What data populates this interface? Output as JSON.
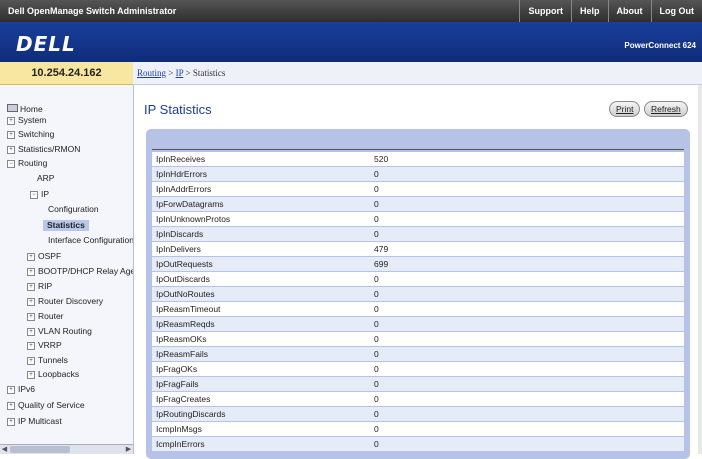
{
  "app_title": "Dell OpenManage Switch Administrator",
  "top_nav": [
    "Support",
    "Help",
    "About",
    "Log Out"
  ],
  "logo_text": "DELL",
  "product_name": "PowerConnect 624",
  "ip_address": "10.254.24.162",
  "breadcrumb": {
    "routing": "Routing",
    "sep1": " > ",
    "ip": "IP",
    "sep2": " > ",
    "current": "Statistics"
  },
  "sidebar": {
    "items": [
      {
        "label": "Home",
        "pm": "",
        "icon": "home-icon"
      },
      {
        "label": "System",
        "pm": "+"
      },
      {
        "label": "Switching",
        "pm": "+"
      },
      {
        "label": "Statistics/RMON",
        "pm": "+"
      },
      {
        "label": "Routing",
        "pm": "−"
      },
      {
        "label": "ARP",
        "pm": ""
      },
      {
        "label": "IP",
        "pm": "−"
      },
      {
        "label": "Configuration",
        "pm": ""
      },
      {
        "label": "Statistics",
        "pm": ""
      },
      {
        "label": "Interface Configuration",
        "pm": ""
      },
      {
        "label": "OSPF",
        "pm": "+"
      },
      {
        "label": "BOOTP/DHCP Relay Agent",
        "pm": "+"
      },
      {
        "label": "RIP",
        "pm": "+"
      },
      {
        "label": "Router Discovery",
        "pm": "+"
      },
      {
        "label": "Router",
        "pm": "+"
      },
      {
        "label": "VLAN Routing",
        "pm": "+"
      },
      {
        "label": "VRRP",
        "pm": "+"
      },
      {
        "label": "Tunnels",
        "pm": "+"
      },
      {
        "label": "Loopbacks",
        "pm": "+"
      },
      {
        "label": "IPv6",
        "pm": "+"
      },
      {
        "label": "Quality of Service",
        "pm": "+"
      },
      {
        "label": "IP Multicast",
        "pm": "+"
      }
    ]
  },
  "main": {
    "title": "IP Statistics",
    "print_label": "Print",
    "refresh_label": "Refresh",
    "rows": [
      {
        "name": "IpInReceives",
        "value": "520"
      },
      {
        "name": "IpInHdrErrors",
        "value": "0"
      },
      {
        "name": "IpInAddrErrors",
        "value": "0"
      },
      {
        "name": "IpForwDatagrams",
        "value": "0"
      },
      {
        "name": "IpInUnknownProtos",
        "value": "0"
      },
      {
        "name": "IpInDiscards",
        "value": "0"
      },
      {
        "name": "IpInDelivers",
        "value": "479"
      },
      {
        "name": "IpOutRequests",
        "value": "699"
      },
      {
        "name": "IpOutDiscards",
        "value": "0"
      },
      {
        "name": "IpOutNoRoutes",
        "value": "0"
      },
      {
        "name": "IpReasmTimeout",
        "value": "0"
      },
      {
        "name": "IpReasmReqds",
        "value": "0"
      },
      {
        "name": "IpReasmOKs",
        "value": "0"
      },
      {
        "name": "IpReasmFails",
        "value": "0"
      },
      {
        "name": "IpFragOKs",
        "value": "0"
      },
      {
        "name": "IpFragFails",
        "value": "0"
      },
      {
        "name": "IpFragCreates",
        "value": "0"
      },
      {
        "name": "IpRoutingDiscards",
        "value": "0"
      },
      {
        "name": "IcmpInMsgs",
        "value": "0"
      },
      {
        "name": "IcmpInErrors",
        "value": "0"
      }
    ]
  },
  "colors": {
    "banner": "#0e2c7a",
    "title": "#1b3f8f",
    "panel": "#b6c3e7",
    "ip_box": "#f7e7a0"
  }
}
